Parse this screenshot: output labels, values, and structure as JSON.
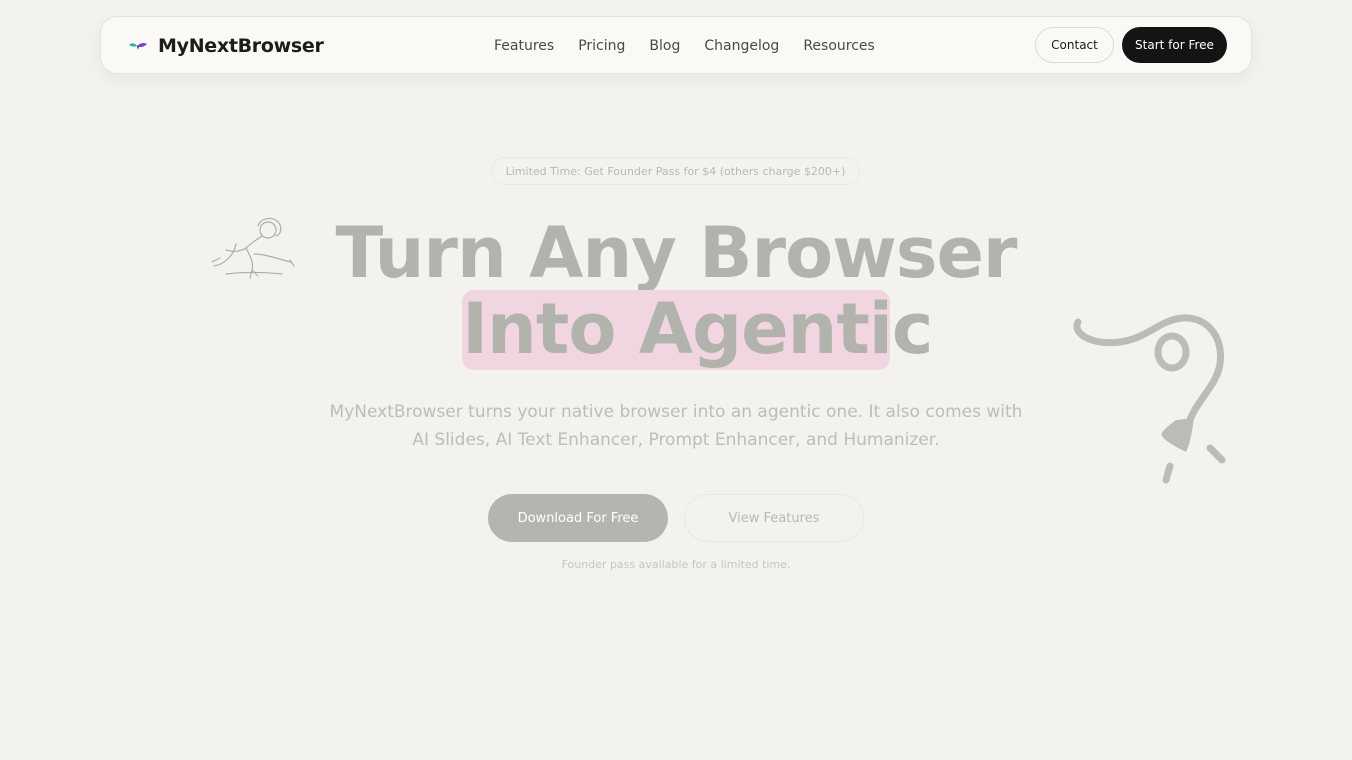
{
  "nav": {
    "brand": "MyNextBrowser",
    "brand_icon": "bird-logo-icon",
    "links": [
      "Features",
      "Pricing",
      "Blog",
      "Changelog",
      "Resources"
    ],
    "contact_label": "Contact",
    "start_label": "Start for Free"
  },
  "hero": {
    "badge": "Limited Time: Get Founder Pass for $4 (others charge $200+)",
    "headline_line1": "Turn Any Browser",
    "headline_line2": "Into Agentic",
    "highlight_color": "#f1d6e2",
    "subtitle": "MyNextBrowser turns your native browser into an agentic one. It also comes with AI Slides, AI Text Enhancer, Prompt Enhancer, and Humanizer.",
    "primary_cta": "Download For Free",
    "secondary_cta": "View Features",
    "footnote": "Founder pass available for a limited time."
  },
  "colors": {
    "background": "#f3f2ee",
    "dark_button": "#141414",
    "accent_pink": "#f1d6e2"
  },
  "icons": {
    "left_illustration": "sketch-girl-icon",
    "right_illustration": "squiggle-arrow-icon"
  }
}
